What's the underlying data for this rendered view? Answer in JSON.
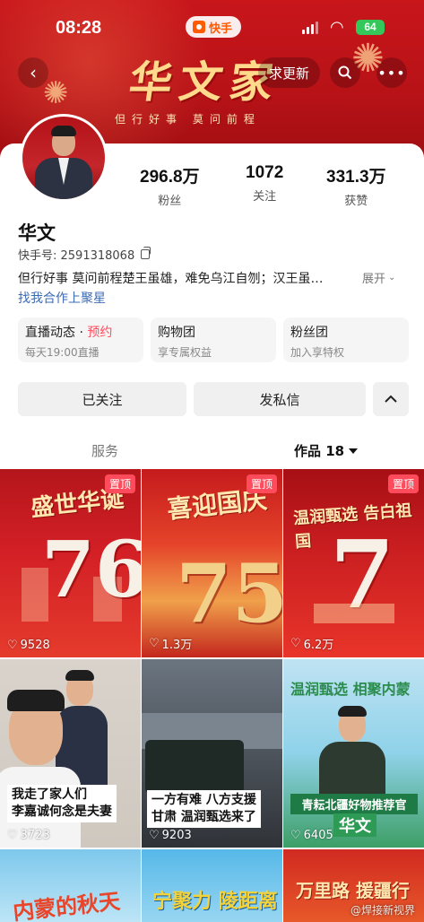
{
  "status_bar": {
    "time": "08:28",
    "app_name": "快手",
    "battery": "64"
  },
  "header": {
    "banner_title": "华文家",
    "banner_slogan": "但行好事 莫问前程",
    "update_label": "求更新",
    "accent_color": "#c8161b"
  },
  "profile": {
    "name": "华文",
    "kuaishou_id": "快手号: 2591318068",
    "bio": "但行好事 莫问前程楚王虽雄，难免乌江自刎；汉王虽…",
    "expand_label": "展开",
    "cooperate_link": "找我合作上聚星",
    "stats": [
      {
        "value": "296.8万",
        "label": "粉丝"
      },
      {
        "value": "1072",
        "label": "关注"
      },
      {
        "value": "331.3万",
        "label": "获赞"
      }
    ]
  },
  "features": [
    {
      "title": "直播动态 · ",
      "highlight": "预约",
      "sub": "每天19:00直播"
    },
    {
      "title": "购物团",
      "highlight": "",
      "sub": "享专属权益"
    },
    {
      "title": "粉丝团",
      "highlight": "",
      "sub": "加入享特权"
    }
  ],
  "actions": {
    "followed": "已关注",
    "message": "发私信",
    "more": "^"
  },
  "tabs": {
    "services": "服务",
    "works": "作品 18"
  },
  "pin_label": "置顶",
  "posts": [
    {
      "title": "盛世华诞",
      "big": "76",
      "likes": "9528",
      "pinned": true
    },
    {
      "title": "喜迎国庆",
      "big": "75",
      "likes": "1.3万",
      "pinned": true
    },
    {
      "title": "温润甄选 告白祖国",
      "big": "7",
      "likes": "6.2万",
      "pinned": true
    },
    {
      "caption": [
        "我走了家人们",
        "李嘉诚何念是夫妻"
      ],
      "likes": "3723"
    },
    {
      "caption": [
        "一方有难 八方支援",
        "甘肃 温润甄选来了"
      ],
      "likes": "9203"
    },
    {
      "title": "温润甄选 相聚内蒙",
      "banner": "青耘北疆好物推荐官",
      "name": "华文",
      "likes": "6405"
    },
    {
      "title": "内蒙的秋天"
    },
    {
      "title": "宁聚力 陵距离"
    },
    {
      "title": "万里路 援疆行"
    }
  ],
  "watermark": "@焊接新视界"
}
